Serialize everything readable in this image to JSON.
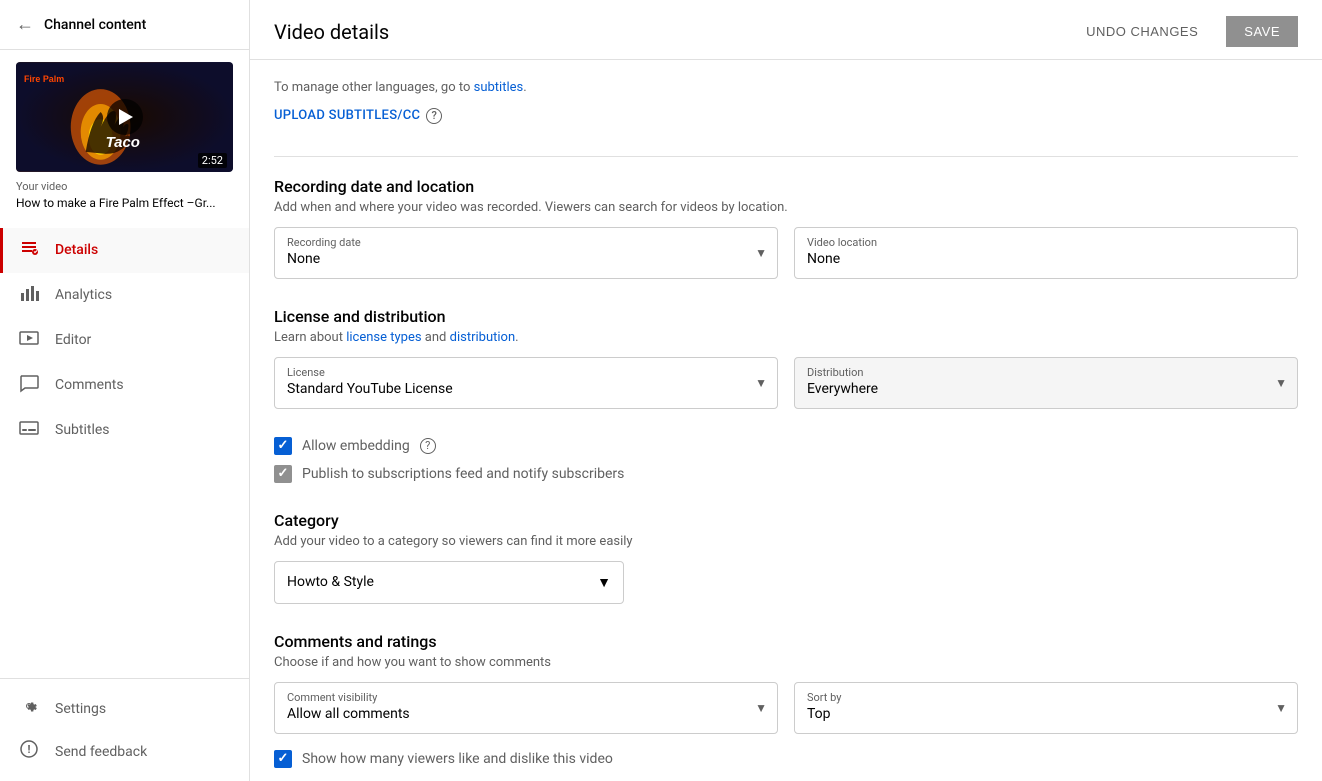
{
  "sidebar": {
    "back_label": "Channel content",
    "video": {
      "title": "How to make a Fire Palm Effect –Gr...",
      "label": "Your video",
      "duration": "2:52"
    },
    "nav_items": [
      {
        "id": "details",
        "label": "Details",
        "icon": "✏️",
        "active": true
      },
      {
        "id": "analytics",
        "label": "Analytics",
        "icon": "📊",
        "active": false
      },
      {
        "id": "editor",
        "label": "Editor",
        "icon": "🎬",
        "active": false
      },
      {
        "id": "comments",
        "label": "Comments",
        "icon": "💬",
        "active": false
      },
      {
        "id": "subtitles",
        "label": "Subtitles",
        "icon": "▬",
        "active": false
      }
    ],
    "bottom_items": [
      {
        "id": "settings",
        "label": "Settings",
        "icon": "⚙️"
      },
      {
        "id": "feedback",
        "label": "Send feedback",
        "icon": "⚠️"
      }
    ]
  },
  "header": {
    "title": "Video details",
    "undo_label": "UNDO CHANGES",
    "save_label": "SAVE"
  },
  "subtitles_section": {
    "desc": "To manage other languages, go to",
    "link_text": "subtitles",
    "upload_label": "UPLOAD SUBTITLES/CC"
  },
  "recording_section": {
    "title": "Recording date and location",
    "desc": "Add when and where your video was recorded. Viewers can search for videos by location.",
    "date_label": "Recording date",
    "date_value": "None",
    "location_label": "Video location",
    "location_value": "None"
  },
  "license_section": {
    "title": "License and distribution",
    "desc_prefix": "Learn about",
    "license_types_link": "license types",
    "and_text": "and",
    "distribution_link": "distribution",
    "license_label": "License",
    "license_value": "Standard YouTube License",
    "distribution_label": "Distribution",
    "distribution_value": "Everywhere"
  },
  "embedding_section": {
    "allow_embedding_label": "Allow embedding",
    "publish_label": "Publish to subscriptions feed and notify subscribers"
  },
  "category_section": {
    "title": "Category",
    "desc": "Add your video to a category so viewers can find it more easily",
    "value": "Howto & Style"
  },
  "comments_section": {
    "title": "Comments and ratings",
    "desc": "Choose if and how you want to show comments",
    "visibility_label": "Comment visibility",
    "visibility_value": "Allow all comments",
    "sort_label": "Sort by",
    "sort_value": "Top",
    "show_likes_label": "Show how many viewers like and dislike this video"
  }
}
